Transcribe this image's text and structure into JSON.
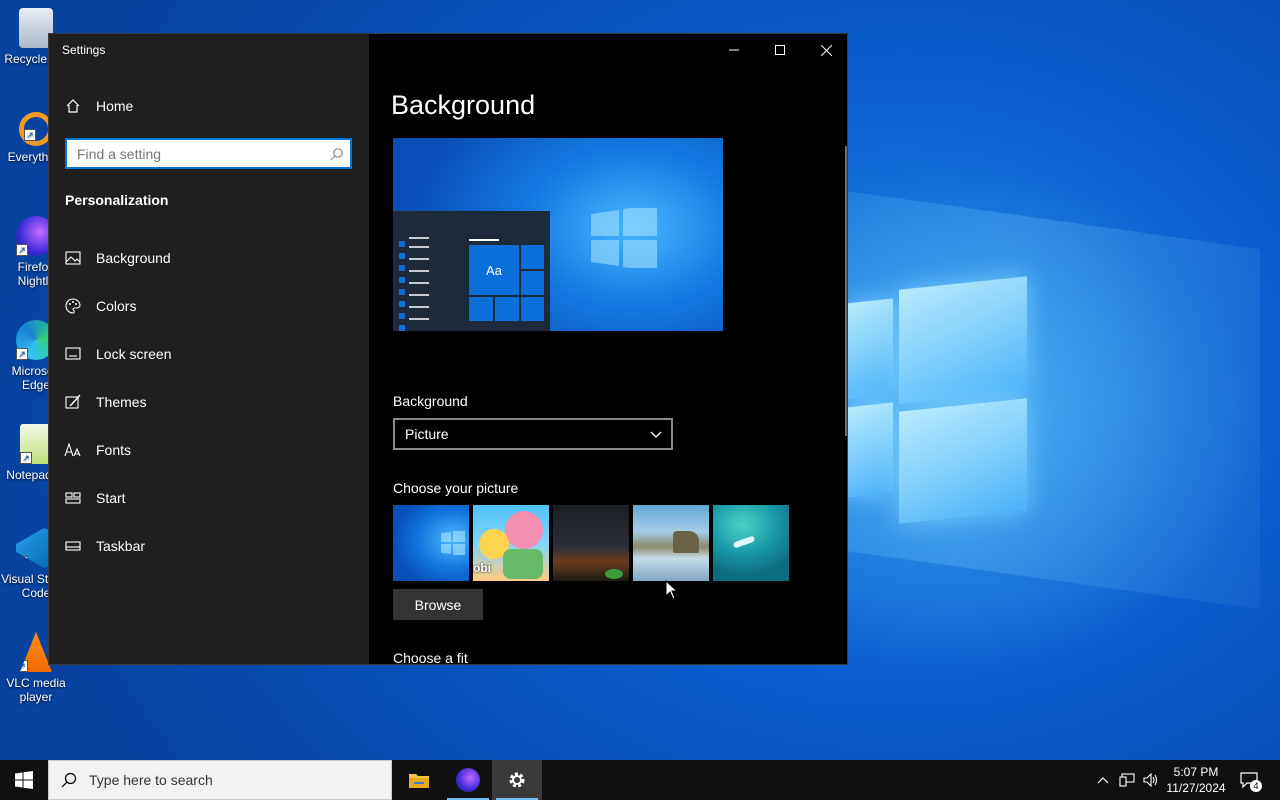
{
  "desktop": {
    "icons": [
      {
        "label": "Recycle Bin",
        "icon": "recycle-bin-icon"
      },
      {
        "label": "Everything",
        "icon": "everything-search-icon"
      },
      {
        "label": "Firefox Nightly",
        "icon": "firefox-nightly-icon"
      },
      {
        "label": "Microsoft Edge",
        "icon": "edge-icon"
      },
      {
        "label": "Notepad++",
        "icon": "notepad-plus-plus-icon"
      },
      {
        "label": "Visual Studio Code",
        "icon": "vscode-icon"
      },
      {
        "label": "VLC media player",
        "icon": "vlc-icon"
      }
    ]
  },
  "window": {
    "title": "Settings",
    "controls": {
      "minimize": "–",
      "maximize": "□",
      "close": "✕"
    }
  },
  "sidebar": {
    "home_label": "Home",
    "search_placeholder": "Find a setting",
    "section_title": "Personalization",
    "items": [
      {
        "label": "Background",
        "icon": "picture-icon"
      },
      {
        "label": "Colors",
        "icon": "palette-icon"
      },
      {
        "label": "Lock screen",
        "icon": "lock-screen-icon"
      },
      {
        "label": "Themes",
        "icon": "themes-brush-icon"
      },
      {
        "label": "Fonts",
        "icon": "fonts-icon"
      },
      {
        "label": "Start",
        "icon": "start-tiles-icon"
      },
      {
        "label": "Taskbar",
        "icon": "taskbar-icon"
      }
    ]
  },
  "content": {
    "page_title": "Background",
    "preview_sample_text": "Aa",
    "background_label": "Background",
    "background_value": "Picture",
    "choose_picture_label": "Choose your picture",
    "browse_label": "Browse",
    "choose_fit_label": "Choose a fit",
    "thumbnails": [
      "windows-blue-wallpaper",
      "cartoon-characters-wallpaper",
      "night-sky-wallpaper",
      "beach-rocks-wallpaper",
      "underwater-swimmer-wallpaper"
    ],
    "thumb_labels": {
      "cartoon": "obi"
    }
  },
  "taskbar": {
    "search_placeholder": "Type here to search",
    "pinned": [
      {
        "name": "file-explorer",
        "active": false
      },
      {
        "name": "firefox-nightly",
        "active": true
      },
      {
        "name": "settings",
        "active": true
      }
    ],
    "clock_time": "5:07 PM",
    "clock_date": "11/27/2024",
    "notification_count": "4"
  },
  "colors": {
    "accent": "#0078d7",
    "sidebar_bg": "#1f1f1f",
    "content_bg": "#000000",
    "taskbar_bg": "#101010"
  }
}
